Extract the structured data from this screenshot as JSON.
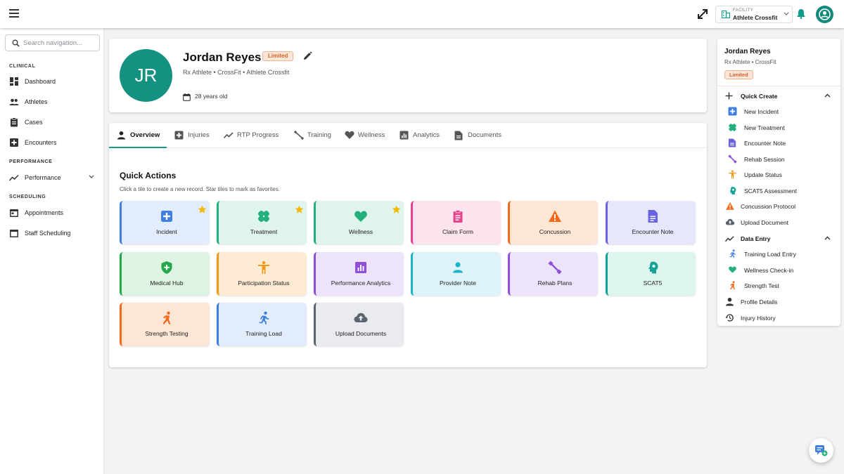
{
  "topbar": {
    "facility_label": "FACILITY",
    "facility_value": "Athlete Crossfit",
    "icons": {
      "menu": "menu-icon",
      "expand": "expand-icon",
      "bell": "bell-icon",
      "account": "account-icon"
    }
  },
  "sidebar": {
    "search_placeholder": "Search navigation...",
    "sections": {
      "clinical": "CLINICAL",
      "performance": "PERFORMANCE",
      "scheduling": "SCHEDULING"
    },
    "items": {
      "dashboard": "Dashboard",
      "athletes": "Athletes",
      "cases": "Cases",
      "encounters": "Encounters",
      "performance": "Performance",
      "appointments": "Appointments",
      "staff_scheduling": "Staff Scheduling"
    }
  },
  "profile": {
    "initials": "JR",
    "name": "Jordan Reyes",
    "status": "Limited",
    "subtitle": "Rx Athlete • CrossFit • Athlete Crossfit",
    "age": "28 years old",
    "avatar_color": "#149180"
  },
  "tabs": {
    "overview": "Overview",
    "injuries": "Injuries",
    "rtp": "RTP Progress",
    "training": "Training",
    "wellness": "Wellness",
    "analytics": "Analytics",
    "documents": "Documents",
    "active": "overview",
    "accent": "#139c8a"
  },
  "quick_actions": {
    "title": "Quick Actions",
    "subtitle": "Click a tile to create a new record. Star tiles to mark as favorites.",
    "tiles": {
      "incident": {
        "label": "Incident",
        "favorite": true
      },
      "treatment": {
        "label": "Treatment",
        "favorite": true
      },
      "wellness": {
        "label": "Wellness",
        "favorite": true
      },
      "claim_form": {
        "label": "Claim Form",
        "favorite": false
      },
      "concussion": {
        "label": "Concussion",
        "favorite": false
      },
      "encounter_note": {
        "label": "Encounter Note",
        "favorite": false
      },
      "medical_hub": {
        "label": "Medical Hub",
        "favorite": false
      },
      "participation_status": {
        "label": "Participation Status",
        "favorite": false
      },
      "performance_analytics": {
        "label": "Performance Analytics",
        "favorite": false
      },
      "provider_note": {
        "label": "Provider Note",
        "favorite": false
      },
      "rehab_plans": {
        "label": "Rehab Plans",
        "favorite": false
      },
      "scat5": {
        "label": "SCAT5",
        "favorite": false
      },
      "strength_testing": {
        "label": "Strength Testing",
        "favorite": false
      },
      "training_load": {
        "label": "Training Load",
        "favorite": false
      },
      "upload_documents": {
        "label": "Upload Documents",
        "favorite": false
      }
    }
  },
  "right_panel": {
    "name": "Jordan Reyes",
    "subtitle": "Rx Athlete • CrossFit",
    "status": "Limited",
    "quick_create": {
      "title": "Quick Create",
      "items": {
        "new_incident": "New Incident",
        "new_treatment": "New Treatment",
        "encounter_note": "Encounter Note",
        "rehab_session": "Rehab Session",
        "update_status": "Update Status",
        "scat5_assessment": "SCAT5 Assessment",
        "concussion_protocol": "Concussion Protocol",
        "upload_document": "Upload Document"
      }
    },
    "data_entry": {
      "title": "Data Entry",
      "items": {
        "training_load_entry": "Training Load Entry",
        "wellness_checkin": "Wellness Check-in",
        "strength_test": "Strength Test"
      }
    },
    "links": {
      "profile_details": "Profile Details",
      "injury_history": "Injury History"
    }
  }
}
